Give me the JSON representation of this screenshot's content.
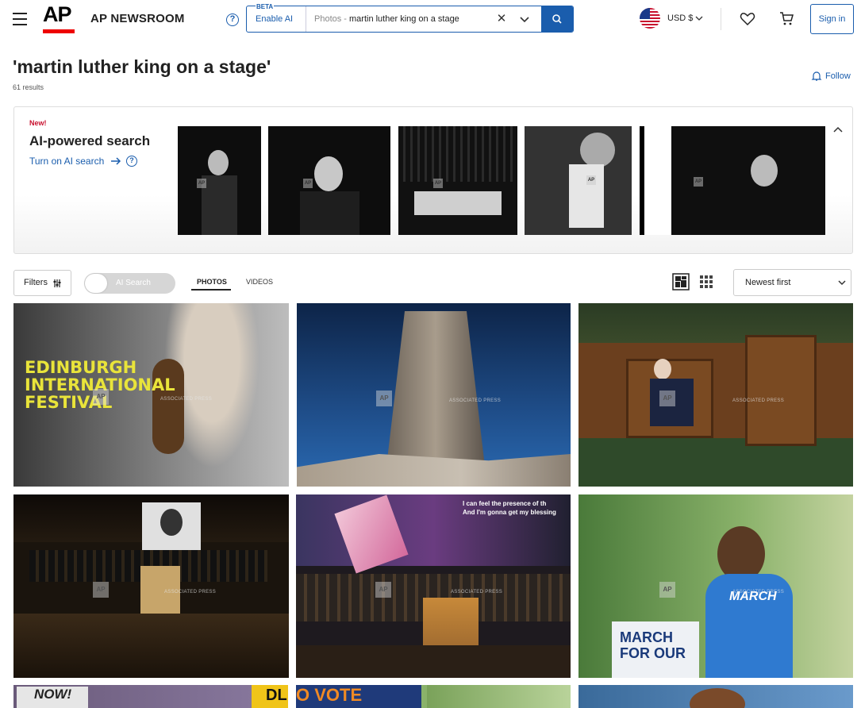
{
  "header": {
    "brand_logo_text": "AP",
    "brand_name": "AP NEWSROOM",
    "beta_label": "BETA",
    "enable_ai_label": "Enable AI",
    "search_scope": "Photos -",
    "search_value": "martin luther king on a stage",
    "currency_label": "USD $",
    "signin_label": "Sign in"
  },
  "page": {
    "title": "'martin luther king on a stage'",
    "results": "61 results",
    "follow_label": "Follow"
  },
  "ai_panel": {
    "new_label": "New!",
    "title": "AI-powered search",
    "turn_on_label": "Turn on AI search"
  },
  "toolbar": {
    "filters_label": "Filters",
    "ai_toggle_label": "AI Search",
    "tabs": [
      "PHOTOS",
      "VIDEOS"
    ],
    "active_tab": "PHOTOS",
    "sort_selected": "Newest first"
  },
  "results": [
    {
      "title": "Edinburgh International Festival",
      "overlay_text": [
        "EDINBURGH",
        "INTERNATIONAL",
        "FESTIVAL"
      ]
    },
    {
      "title": "Martin Luther King Jr. Memorial"
    },
    {
      "title": "Seated man in church pulpit chair"
    },
    {
      "title": "Church service with MLK portrait on screen"
    },
    {
      "title": "Church performance with banners",
      "overlay_text": [
        "I can feel the presence of th",
        "And I'm gonna get my blessing"
      ]
    },
    {
      "title": "Girl speaking at podium",
      "overlay_text": [
        "MARCH",
        "MARCH",
        "FOR OUR"
      ]
    },
    {
      "title": "Protest signs",
      "overlay_text": [
        "NOW!",
        "DL"
      ]
    },
    {
      "title": "Vote sign",
      "overlay_text": [
        "O VOTE"
      ]
    },
    {
      "title": "Man outdoors"
    }
  ],
  "watermark_text": "ASSOCIATED PRESS",
  "colors": {
    "accent": "#1a5dad",
    "brand_red": "#e00000"
  }
}
